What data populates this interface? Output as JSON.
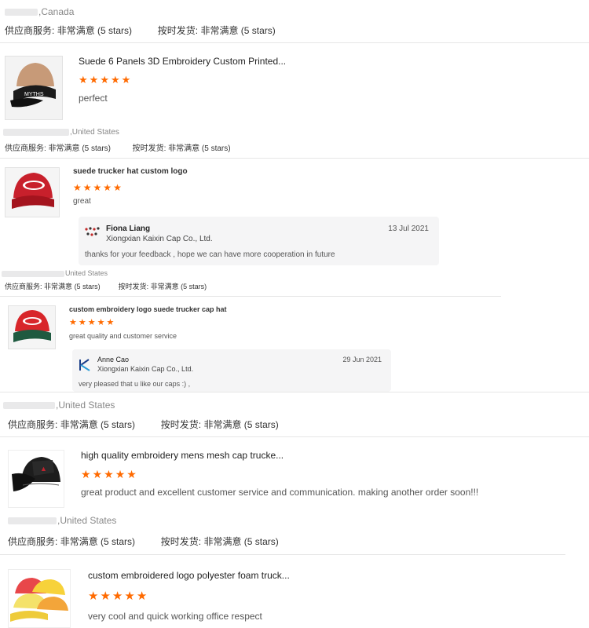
{
  "reviews": [
    {
      "country": ",Canada",
      "supplier_label": "供应商服务:",
      "supplier_value": "非常满意",
      "supplier_stars": "(5 stars)",
      "ship_label": "按时发货:",
      "ship_value": "非常满意",
      "ship_stars": "(5 stars)"
    },
    {
      "title": "Suede 6 Panels 3D Embroidery Custom Printed...",
      "rating": 5,
      "comment": "perfect",
      "country": ",United States",
      "supplier_label": "供应商服务:",
      "supplier_value": "非常满意",
      "supplier_stars": "(5 stars)",
      "ship_label": "按时发货:",
      "ship_value": "非常满意",
      "ship_stars": "(5 stars)"
    },
    {
      "title": "suede trucker hat custom logo",
      "rating": 5,
      "comment": "great",
      "reply": {
        "name": "Fiona Liang",
        "company": "Xiongxian Kaixin Cap Co., Ltd.",
        "date": "13 Jul 2021",
        "text": "thanks for your feedback , hope we can have more cooperation in future"
      },
      "country": "United States",
      "supplier_label": "供应商服务:",
      "supplier_value": "非常满意",
      "supplier_stars": "(5 stars)",
      "ship_label": "按时发货:",
      "ship_value": "非常满意",
      "ship_stars": "(5 stars)"
    },
    {
      "title": "custom embroidery logo suede trucker cap hat",
      "rating": 5,
      "comment": "great quality and customer service",
      "reply": {
        "name": "Anne Cao",
        "company": "Xiongxian Kaixin Cap Co., Ltd.",
        "date": "29 Jun 2021",
        "text": "very pleased  that u like our caps :) ,"
      },
      "country": ",United States",
      "supplier_label": "供应商服务:",
      "supplier_value": "非常满意",
      "supplier_stars": "(5 stars)",
      "ship_label": "按时发货:",
      "ship_value": "非常满意",
      "ship_stars": "(5 stars)"
    },
    {
      "title": "high quality embroidery mens mesh cap trucke...",
      "rating": 5,
      "comment": "great product and excellent customer service and communication. making another order soon!!!",
      "country": ",United States",
      "supplier_label": "供应商服务:",
      "supplier_value": "非常满意",
      "supplier_stars": "(5 stars)",
      "ship_label": "按时发货:",
      "ship_value": "非常满意",
      "ship_stars": "(5 stars)"
    },
    {
      "title": "custom embroidered logo polyester foam truck...",
      "rating": 5,
      "comment": "very cool and quick working office respect"
    }
  ],
  "colors": {
    "star": "#ff6a00",
    "divider": "#e6e6e6",
    "reply_bg": "#f5f5f6"
  },
  "icons": {
    "rating": "star-icon",
    "reply_avatar": "supplier-logo-icon"
  }
}
